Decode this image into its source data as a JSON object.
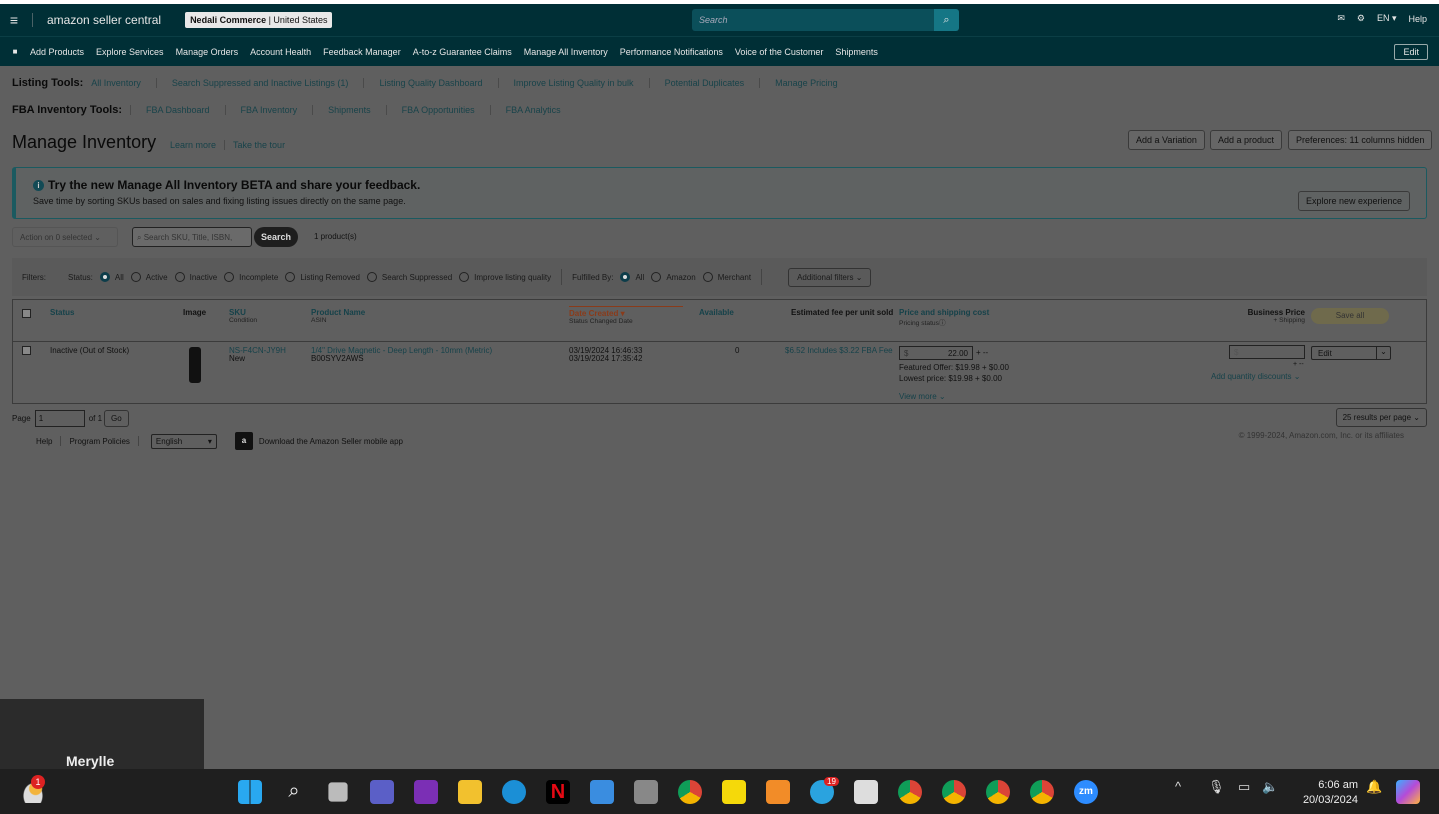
{
  "header": {
    "logo": "amazon seller central",
    "store_name": "Nedali Commerce",
    "store_region": " | United States",
    "search_placeholder": "Search",
    "lang": "EN",
    "help": "Help"
  },
  "nav": {
    "items": [
      "Add Products",
      "Explore Services",
      "Manage Orders",
      "Account Health",
      "Feedback Manager",
      "A-to-z Guarantee Claims",
      "Manage All Inventory",
      "Performance Notifications",
      "Voice of the Customer",
      "Shipments"
    ],
    "edit": "Edit"
  },
  "listing_tools": {
    "label": "Listing Tools:",
    "links": [
      "All Inventory",
      "Search Suppressed and Inactive Listings (1)",
      "Listing Quality Dashboard",
      "Improve Listing Quality in bulk",
      "Potential Duplicates",
      "Manage Pricing"
    ]
  },
  "fba_tools": {
    "label": "FBA Inventory Tools:",
    "links": [
      "FBA Dashboard",
      "FBA Inventory",
      "Shipments",
      "FBA Opportunities",
      "FBA Analytics"
    ]
  },
  "page": {
    "title": "Manage Inventory",
    "learn_more": "Learn more",
    "tour": "Take the tour",
    "add_variation": "Add a Variation",
    "add_product": "Add a product",
    "preferences": "Preferences: 11 columns hidden"
  },
  "banner": {
    "title": "Try the new Manage All Inventory BETA and share your feedback.",
    "subtitle": "Save time by sorting SKUs based on sales and fixing listing issues directly on the same page.",
    "button": "Explore new experience"
  },
  "toolbar": {
    "action": "Action on 0 selected",
    "search_placeholder": "Search SKU, Title, ISBN,",
    "search_btn": "Search",
    "count": "1 product(s)"
  },
  "filters": {
    "label": "Filters:",
    "status_label": "Status:",
    "status_options": [
      "All",
      "Active",
      "Inactive",
      "Incomplete",
      "Listing Removed",
      "Search Suppressed",
      "Improve listing quality"
    ],
    "fulfilled_label": "Fulfilled By:",
    "fulfilled_options": [
      "All",
      "Amazon",
      "Merchant"
    ],
    "additional": "Additional filters"
  },
  "table": {
    "headers": {
      "status": "Status",
      "image": "Image",
      "sku": "SKU",
      "sku_sub": "Condition",
      "product": "Product Name",
      "product_sub": "ASIN",
      "date": "Date Created",
      "date_sub": "Status Changed Date",
      "available": "Available",
      "fee": "Estimated fee per unit sold",
      "price": "Price and shipping cost",
      "price_sub": "Pricing status",
      "business": "Business Price",
      "business_sub": "+ Shipping",
      "save_all": "Save all"
    },
    "row": {
      "status": "Inactive (Out of Stock)",
      "sku": "NS-F4CN-JY9H",
      "condition": "New",
      "product": "1/4\" Drive Magnetic - Deep Length - 10mm (Metric)",
      "asin": "B00SYV2AWS",
      "date_created": "03/19/2024 16:46:33",
      "date_changed": "03/19/2024 17:35:42",
      "available": "0",
      "fee": "$6.52 Includes $3.22 FBA Fee",
      "price_symbol": "$",
      "price": "22.00",
      "price_plus": "+ --",
      "featured": "Featured Offer: $19.98 + $0.00",
      "lowest": "Lowest price: $19.98 + $0.00",
      "view_more": "View more",
      "biz_symbol": "$",
      "biz_plus": "+ --",
      "qty_discounts": "Add quantity discounts",
      "edit": "Edit"
    }
  },
  "pager": {
    "page_label": "Page",
    "page_value": "1",
    "of": "of 1",
    "go": "Go",
    "per_page": "25 results per page"
  },
  "footer": {
    "help": "Help",
    "policies": "Program Policies",
    "language": "English",
    "app": "Download the Amazon Seller mobile app",
    "copyright": "© 1999-2024, Amazon.com, Inc. or its affiliates"
  },
  "toast": {
    "name": "Meryllе"
  },
  "taskbar": {
    "weather_badge": "1",
    "telegram_badge": "19",
    "time": "6:06 am",
    "date": "20/03/2024"
  }
}
